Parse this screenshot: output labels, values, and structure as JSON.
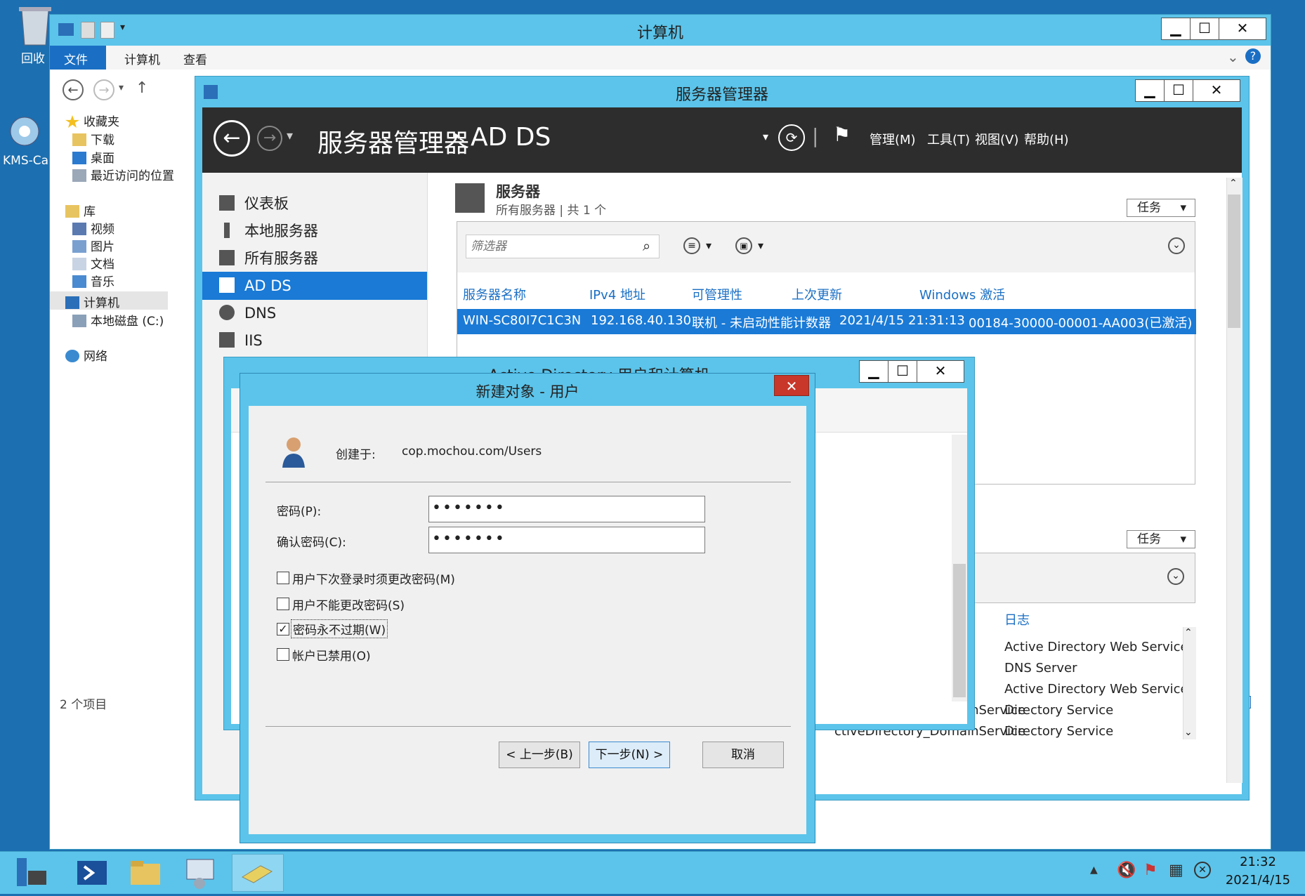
{
  "desktop": {
    "icons": [
      {
        "label": "回收",
        "name": "recycle-bin"
      },
      {
        "label": "KMS-Ca",
        "name": "kms-app"
      }
    ]
  },
  "explorer": {
    "title": "计算机",
    "ribbon_tabs": [
      "文件",
      "计算机",
      "查看"
    ],
    "nav": {
      "favorites": "收藏夹",
      "downloads": "下载",
      "desktop": "桌面",
      "recent": "最近访问的位置",
      "libraries": "库",
      "videos": "视频",
      "pictures": "图片",
      "documents": "文档",
      "music": "音乐",
      "computer": "计算机",
      "local_disk": "本地磁盘 (C:)",
      "network": "网络"
    },
    "status": "2 个项目"
  },
  "server_manager": {
    "title": "服务器管理器",
    "breadcrumb_root": "服务器管理器",
    "breadcrumb_sep": "‣",
    "breadcrumb_current": "AD DS",
    "menus": [
      "管理(M)",
      "工具(T)",
      "视图(V)",
      "帮助(H)"
    ],
    "sidebar": [
      {
        "label": "仪表板"
      },
      {
        "label": "本地服务器"
      },
      {
        "label": "所有服务器"
      },
      {
        "label": "AD DS",
        "selected": true
      },
      {
        "label": "DNS"
      },
      {
        "label": "IIS"
      }
    ],
    "servers_section": {
      "title": "服务器",
      "subtitle": "所有服务器 | 共 1 个",
      "tasks_label": "任务",
      "filter_placeholder": "筛选器",
      "columns": [
        "服务器名称",
        "IPv4 地址",
        "可管理性",
        "上次更新",
        "Windows 激活"
      ],
      "row": [
        "WIN-SC80I7C1C3N",
        "192.168.40.130",
        "联机 - 未启动性能计数器",
        "2021/4/15 21:31:13",
        "00184-30000-00001-AA003(已激活)"
      ]
    },
    "events_section": {
      "tasks_label": "任务",
      "log_header": "日志",
      "rows": [
        {
          "left": "",
          "right": "Active Directory Web Service"
        },
        {
          "left": "",
          "right": "DNS Server"
        },
        {
          "left": "",
          "right": "Active Directory Web Service"
        },
        {
          "left": "ctiveDirectory_DomainService",
          "right": "Directory Service"
        },
        {
          "left": "ctiveDirectory_DomainService",
          "right": "Directory Service"
        }
      ]
    }
  },
  "aduc": {
    "title": "Active Directory 用户和计算机"
  },
  "dialog": {
    "title": "新建对象 - 用户",
    "close": "✕",
    "created_in_label": "创建于:",
    "created_in_value": "cop.mochou.com/Users",
    "password_label": "密码(P):",
    "password_value": "•••••••",
    "confirm_label": "确认密码(C):",
    "confirm_value": "•••••••",
    "checkboxes": [
      {
        "label": "用户下次登录时须更改密码(M)",
        "checked": false
      },
      {
        "label": "用户不能更改密码(S)",
        "checked": false
      },
      {
        "label": "密码永不过期(W)",
        "checked": true
      },
      {
        "label": "帐户已禁用(O)",
        "checked": false
      }
    ],
    "back_button": "< 上一步(B)",
    "next_button": "下一步(N) >",
    "cancel_button": "取消"
  },
  "window_controls": {
    "minimize": "▁",
    "maximize": "☐",
    "close": "✕"
  },
  "taskbar": {
    "time": "21:32",
    "date": "2021/4/15"
  },
  "colors": {
    "window_frame": "#5cc4ea",
    "selection": "#1a7ad6",
    "close_red": "#c9362a",
    "header_dark": "#2d2d2d"
  }
}
